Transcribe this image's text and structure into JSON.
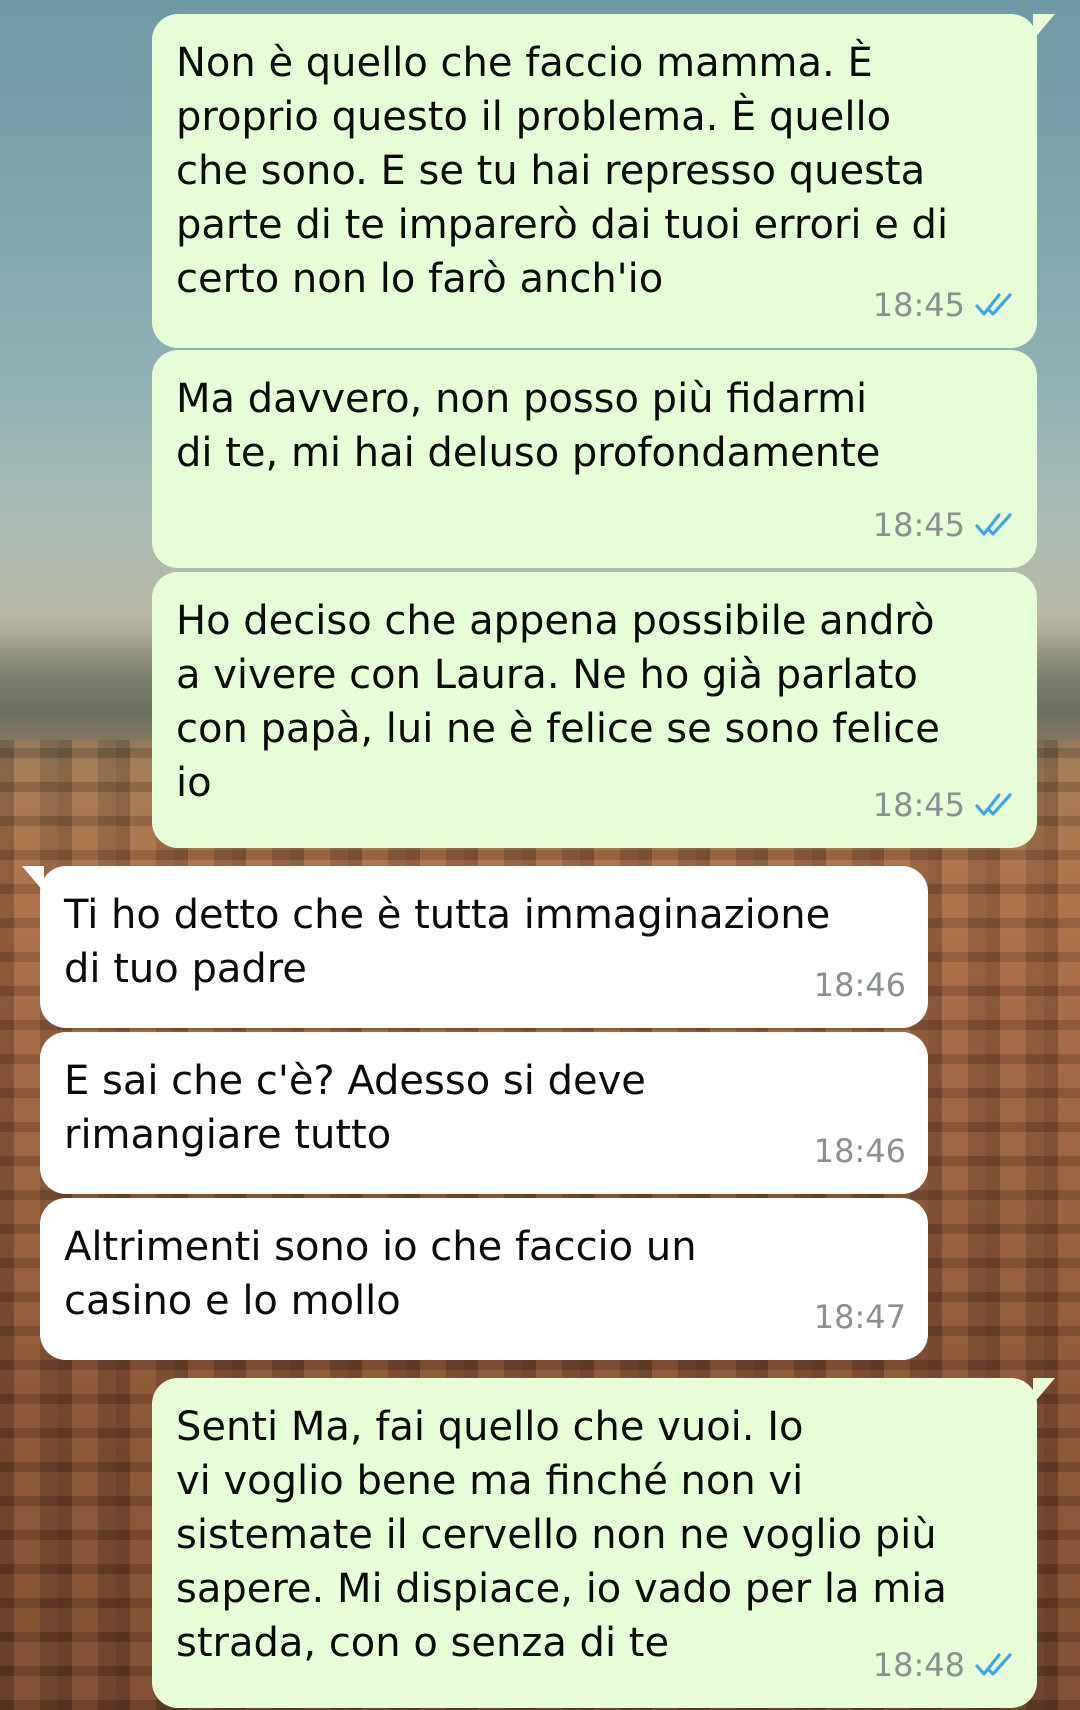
{
  "colors": {
    "outgoing_bubble": "#e7fdd8",
    "incoming_bubble": "#ffffff",
    "read_ticks": "#3ea6e8",
    "timestamp": "#8a8f92"
  },
  "messages": [
    {
      "direction": "outgoing",
      "text": "Non è quello che faccio mamma. È\nproprio questo il problema. È quello\nche sono. E se tu hai represso questa\nparte di te imparerò dai tuoi errori e di\ncerto non lo farò anch'io",
      "time": "18:45",
      "status_icon": "double-check-read-icon"
    },
    {
      "direction": "outgoing",
      "text": "Ma davvero, non posso più fidarmi\ndi te, mi hai deluso profondamente",
      "time": "18:45",
      "status_icon": "double-check-read-icon"
    },
    {
      "direction": "outgoing",
      "text": "Ho deciso che appena possibile andrò\na vivere con Laura. Ne ho già parlato\ncon papà, lui ne è felice se sono felice\nio",
      "time": "18:45",
      "status_icon": "double-check-read-icon"
    },
    {
      "direction": "incoming",
      "text": "Ti ho detto che è tutta immaginazione\ndi tuo padre",
      "time": "18:46"
    },
    {
      "direction": "incoming",
      "text": "E sai che c'è? Adesso si deve\nrimangiare tutto",
      "time": "18:46"
    },
    {
      "direction": "incoming",
      "text": "Altrimenti sono io che faccio un\ncasino e lo mollo",
      "time": "18:47"
    },
    {
      "direction": "outgoing",
      "text": "Senti Ma, fai quello che vuoi. Io\nvi voglio bene ma finché non vi\nsistemate il cervello non ne voglio più\nsapere. Mi dispiace, io vado per la mia\nstrada, con o senza di te",
      "time": "18:48",
      "status_icon": "double-check-read-icon"
    }
  ]
}
